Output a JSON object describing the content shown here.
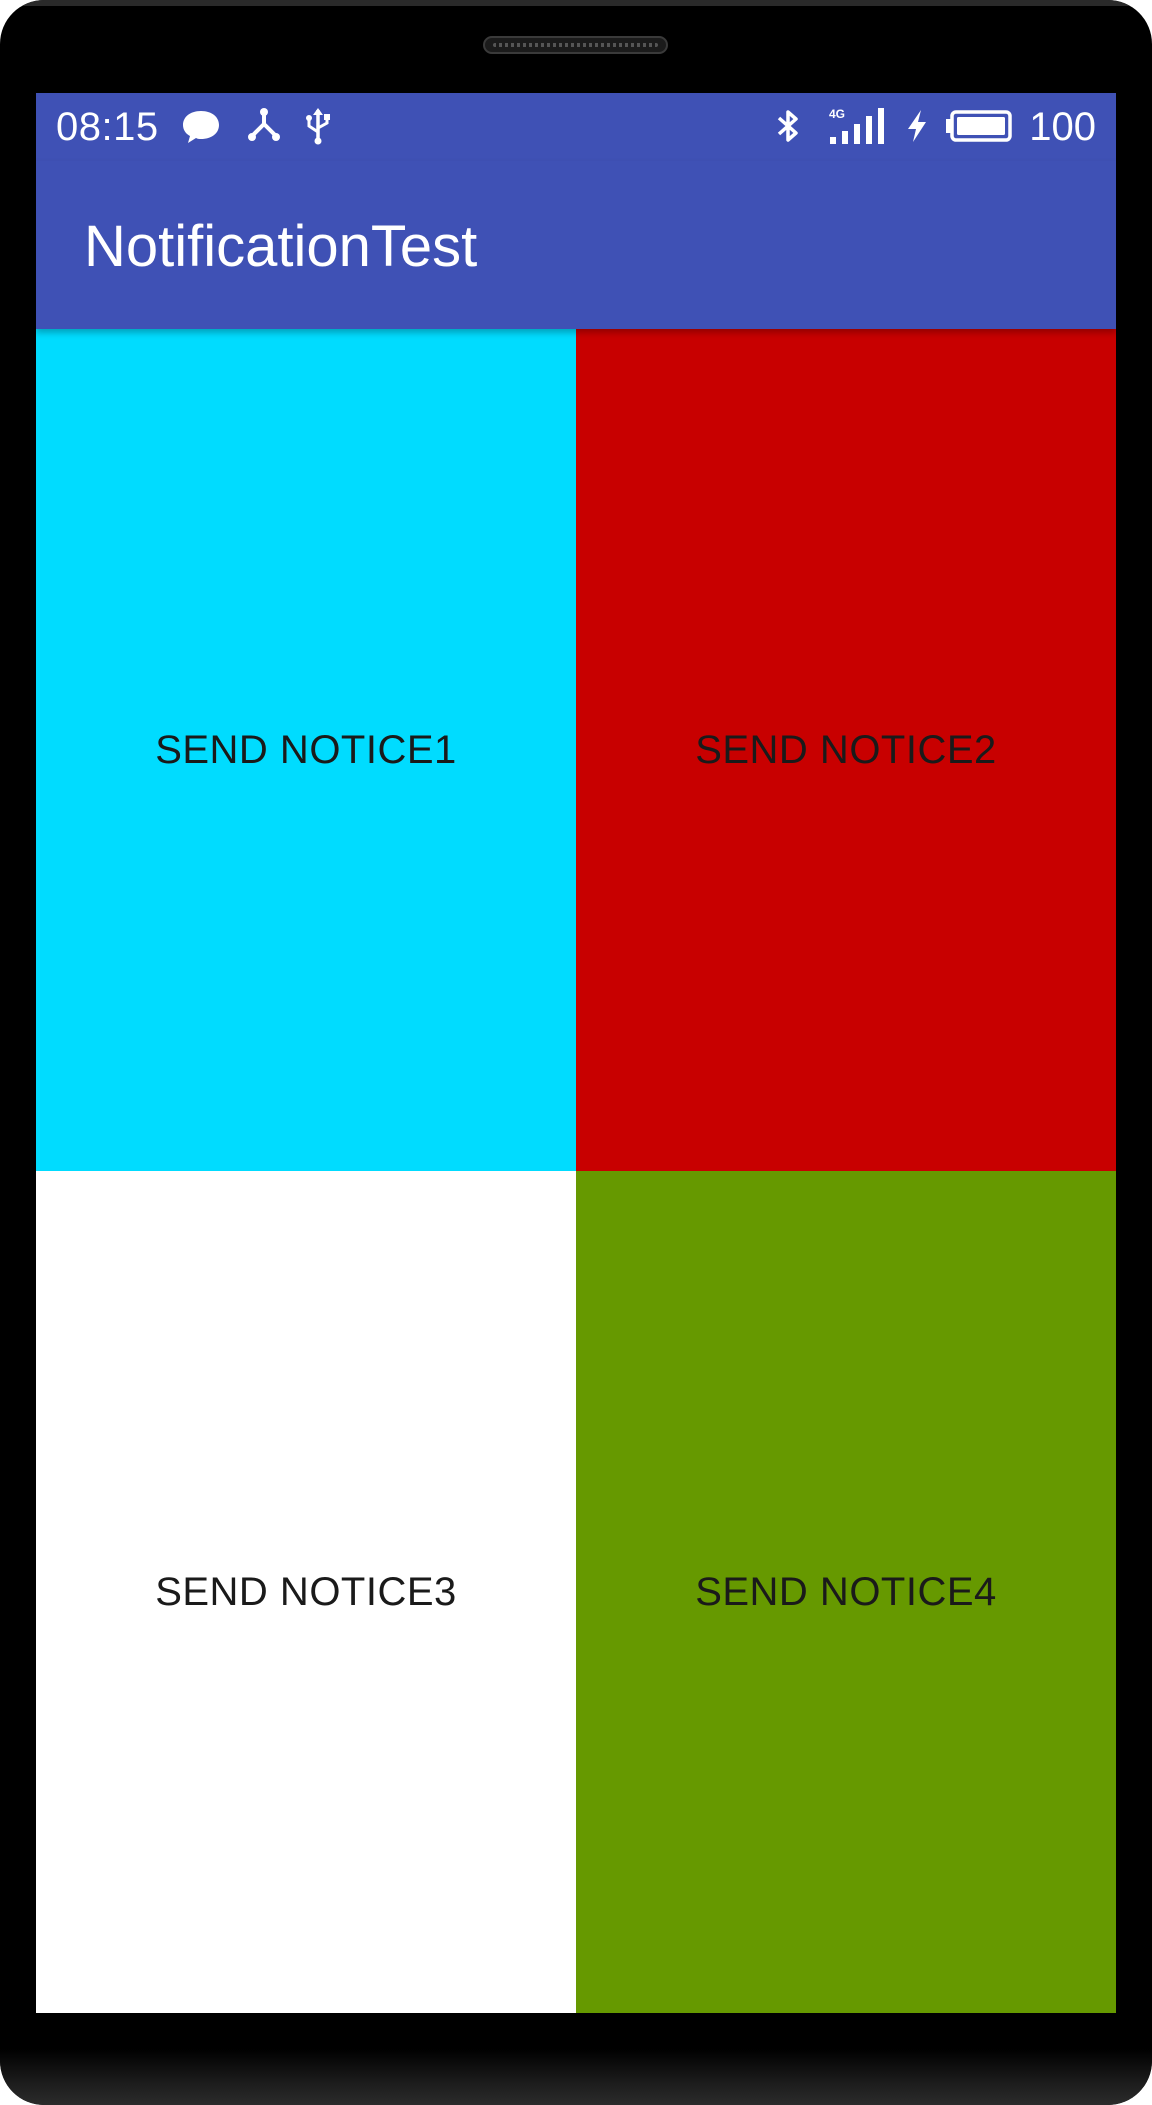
{
  "status_bar": {
    "time": "08:15",
    "battery_level": "100",
    "left_icons": [
      "chat-bubble-icon",
      "share-hub-icon",
      "usb-icon"
    ],
    "right_icons": [
      "bluetooth-icon",
      "signal-4g-icon",
      "charging-icon",
      "battery-icon"
    ],
    "network_label": "4G",
    "background_color": "#3f51b5"
  },
  "app_bar": {
    "title": "NotificationTest",
    "background_color": "#3f51b5"
  },
  "buttons": [
    {
      "label": "SEND NOTICE1",
      "color": "#00dcff"
    },
    {
      "label": "SEND NOTICE2",
      "color": "#c80000"
    },
    {
      "label": "SEND NOTICE3",
      "color": "#ffffff"
    },
    {
      "label": "SEND NOTICE4",
      "color": "#669900"
    }
  ]
}
